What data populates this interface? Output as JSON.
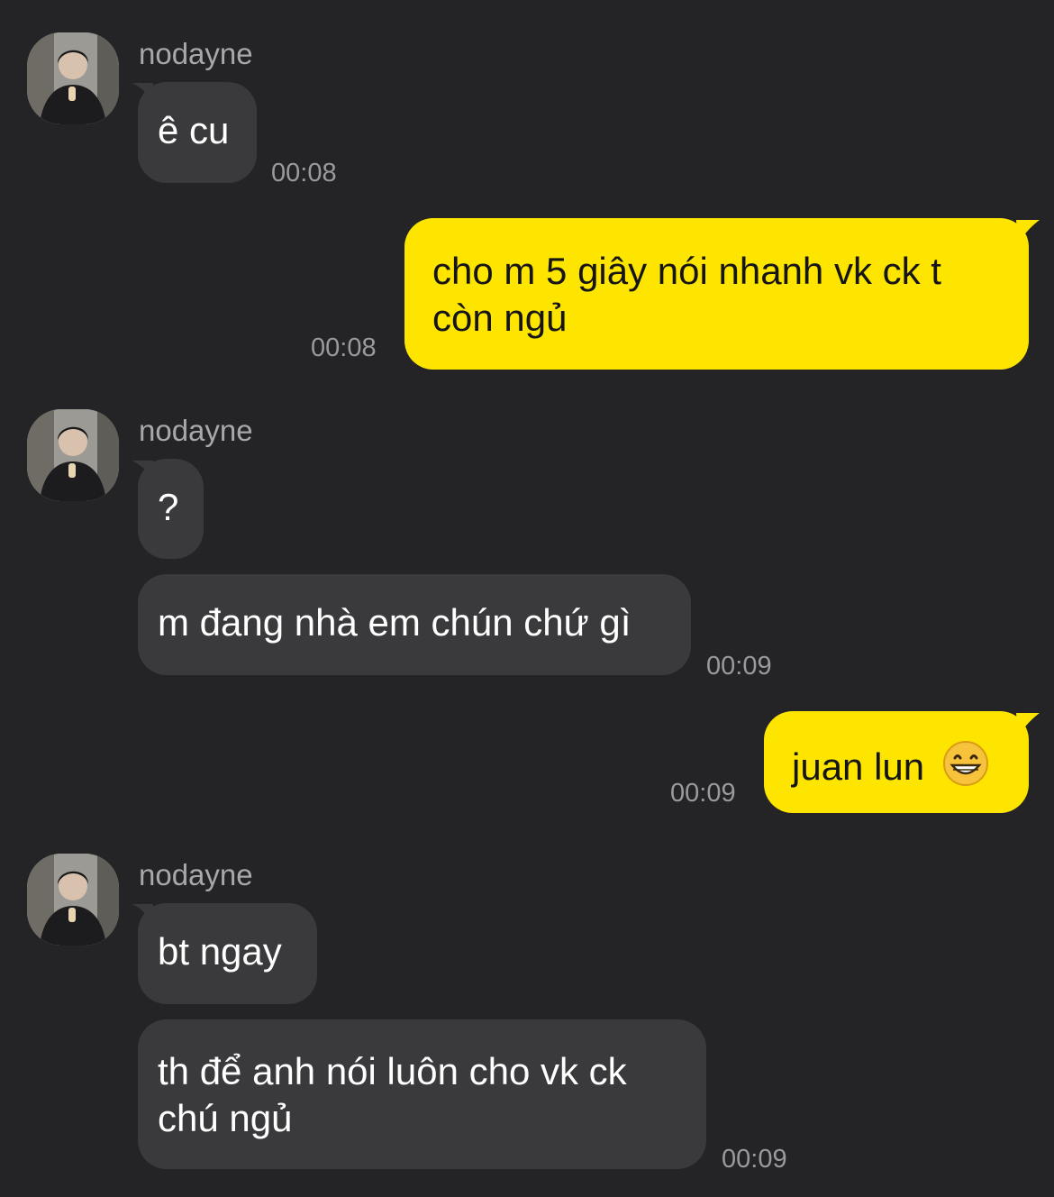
{
  "colors": {
    "background": "#242426",
    "incoming_bubble": "#3a3a3c",
    "outgoing_bubble": "#fee500"
  },
  "messages": [
    {
      "sender": "nodayne",
      "avatar": "profile-photo",
      "text": "ê cu",
      "time": "00:08"
    },
    {
      "text": "cho m 5 giây nói nhanh vk ck t",
      "text2": "còn ngủ",
      "time": "00:08"
    },
    {
      "sender": "nodayne",
      "avatar": "profile-photo",
      "text": "?"
    },
    {
      "text": "m đang nhà em chún chứ gì",
      "time": "00:09"
    },
    {
      "text": "juan lun",
      "emoji": "grinning-face-icon",
      "time": "00:09"
    },
    {
      "sender": "nodayne",
      "avatar": "profile-photo",
      "text": "bt ngay"
    },
    {
      "text": "th để anh nói luôn cho vk ck",
      "text2": "chú ngủ",
      "time": "00:09"
    }
  ]
}
